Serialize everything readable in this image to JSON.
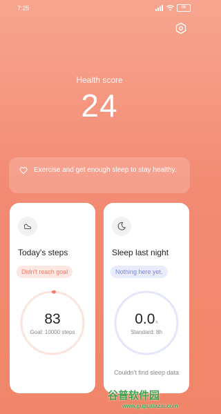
{
  "status_bar": {
    "time": "7:25",
    "battery": "86"
  },
  "health": {
    "title": "Health score",
    "score": "24"
  },
  "tip": {
    "text": "Exercise and get enough sleep to stay healthy."
  },
  "steps_card": {
    "title": "Today's steps",
    "badge": "Didn't reach goal",
    "value": "83",
    "goal_text": "Goal: 10000 steps",
    "progress": 0.0083
  },
  "sleep_card": {
    "title": "Sleep last night",
    "badge": "Nothing here yet.",
    "value": "0.0",
    "unit": "h",
    "standard_text": "Standard: 8h",
    "no_data": "Couldn't find sleep data"
  },
  "watermark": {
    "text": "谷普软件园",
    "url": "www.gupuxiazai.com"
  },
  "colors": {
    "accent": "#ef7b68",
    "sleep_accent": "#7b86d8",
    "bg_top": "#f7a58f",
    "bg_bottom": "#f08569"
  }
}
